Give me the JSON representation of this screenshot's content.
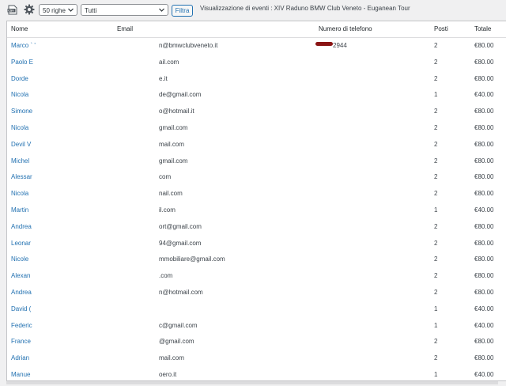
{
  "toolbar": {
    "rows_select": "50 righe",
    "status_select": "Tutti",
    "filter_label": "Filtra",
    "title": "Visualizzazione di eventi : XIV Raduno BMW Club Veneto - Euganean Tour",
    "csv_icon": "csv-export-icon",
    "gear_icon": "gear-icon"
  },
  "table": {
    "headers": {
      "name": "Nome",
      "email": "Email",
      "phone": "Numero di telefono",
      "seats": "Posti",
      "total": "Totale"
    },
    "rows": [
      {
        "name": "Marco ` '",
        "email": "n@bmwclubveneto.it",
        "phone": "2944",
        "seats": "2",
        "total": "€80.00"
      },
      {
        "name": "Paolo E",
        "email": "ail.com",
        "phone": "",
        "seats": "2",
        "total": "€80.00"
      },
      {
        "name": "Dorde",
        "email": "e.it",
        "phone": "",
        "seats": "2",
        "total": "€80.00"
      },
      {
        "name": "Nicola",
        "email": "de@gmail.com",
        "phone": "",
        "seats": "1",
        "total": "€40.00"
      },
      {
        "name": "Simone",
        "email": "o@hotmail.it",
        "phone": "",
        "seats": "2",
        "total": "€80.00"
      },
      {
        "name": "Nicola",
        "email": "gmail.com",
        "phone": "",
        "seats": "2",
        "total": "€80.00"
      },
      {
        "name": "Devil V",
        "email": "mail.com",
        "phone": "",
        "seats": "2",
        "total": "€80.00"
      },
      {
        "name": "Michel",
        "email": "gmail.com",
        "phone": "",
        "seats": "2",
        "total": "€80.00"
      },
      {
        "name": "Alessar",
        "email": "com",
        "phone": "",
        "seats": "2",
        "total": "€80.00"
      },
      {
        "name": "Nicola",
        "email": "nail.com",
        "phone": "",
        "seats": "2",
        "total": "€80.00"
      },
      {
        "name": "Martin",
        "email": "il.com",
        "phone": "",
        "seats": "1",
        "total": "€40.00"
      },
      {
        "name": "Andrea",
        "email": "ort@gmail.com",
        "phone": "",
        "seats": "2",
        "total": "€80.00"
      },
      {
        "name": "Leonar",
        "email": "94@gmail.com",
        "phone": "",
        "seats": "2",
        "total": "€80.00"
      },
      {
        "name": "Nicole",
        "email": "mmobiliare@gmail.com",
        "phone": "",
        "seats": "2",
        "total": "€80.00"
      },
      {
        "name": "Alexan",
        "email": ".com",
        "phone": "",
        "seats": "2",
        "total": "€80.00"
      },
      {
        "name": "Andrea",
        "email": "n@hotmail.com",
        "phone": "",
        "seats": "2",
        "total": "€80.00"
      },
      {
        "name": "David (",
        "email": "",
        "phone": "",
        "seats": "1",
        "total": "€40.00"
      },
      {
        "name": "Federic",
        "email": "c@gmail.com",
        "phone": "",
        "seats": "1",
        "total": "€40.00"
      },
      {
        "name": "France",
        "email": "@gmail.com",
        "phone": "",
        "seats": "2",
        "total": "€80.00"
      },
      {
        "name": "Adrian",
        "email": "mail.com",
        "phone": "",
        "seats": "2",
        "total": "€80.00"
      },
      {
        "name": "Manue",
        "email": "oero.it",
        "phone": "",
        "seats": "1",
        "total": "€40.00"
      }
    ]
  },
  "colors": {
    "link": "#2271b1",
    "redaction": "#8a1414"
  }
}
